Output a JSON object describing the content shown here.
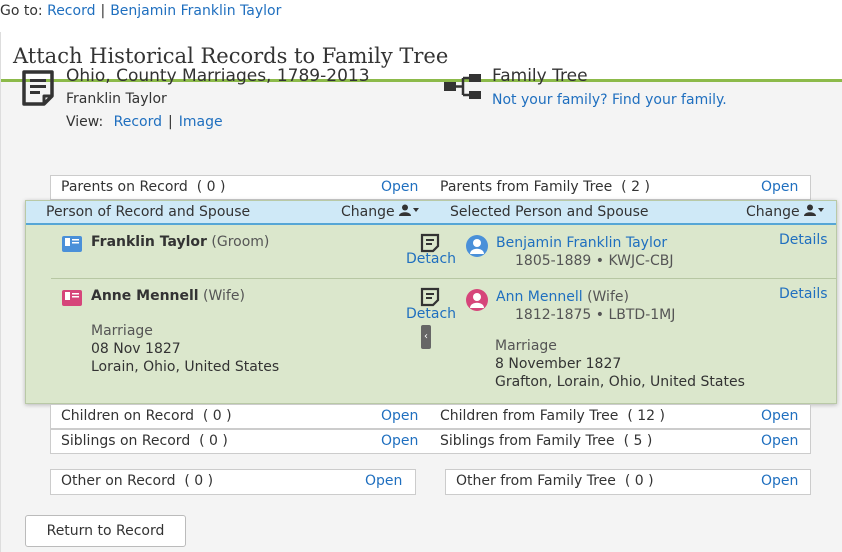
{
  "goto": {
    "label": "Go to:",
    "links": [
      "Record",
      "Benjamin Franklin Taylor"
    ],
    "separator": "|"
  },
  "title": "Attach Historical Records to Family Tree",
  "record": {
    "title": "Ohio, County Marriages, 1789-2013",
    "subject": "Franklin Taylor",
    "view_label": "View:",
    "view_links": [
      "Record",
      "Image"
    ],
    "separator": "|"
  },
  "tree": {
    "title": "Family Tree",
    "link": "Not your family? Find your family."
  },
  "parents_row": {
    "left_label": "Parents on Record",
    "left_count": "( 0 )",
    "left_action": "Open",
    "right_label": "Parents from Family Tree",
    "right_count": "( 2 )",
    "right_action": "Open"
  },
  "panel": {
    "left_header": "Person of Record and Spouse",
    "left_change": "Change",
    "right_header": "Selected Person and Spouse",
    "right_change": "Change",
    "persons": [
      {
        "record_name": "Franklin Taylor",
        "record_role": "(Groom)",
        "detach": "Detach",
        "tree_name": "Benjamin Franklin Taylor",
        "tree_role": "",
        "tree_meta": "1805-1889 • KWJC-CBJ",
        "details": "Details"
      },
      {
        "record_name": "Anne Mennell",
        "record_role": "(Wife)",
        "detach": "Detach",
        "tree_name": "Ann Mennell",
        "tree_role": "(Wife)",
        "tree_meta": "1812-1875 • LBTD-1MJ",
        "details": "Details"
      }
    ],
    "record_event": {
      "type": "Marriage",
      "date": "08 Nov 1827",
      "place": "Lorain, Ohio, United States"
    },
    "tree_event": {
      "type": "Marriage",
      "date": "8 November 1827",
      "place": "Grafton, Lorain, Ohio, United States"
    },
    "collapse_glyph": "‹"
  },
  "children_row": {
    "left_label": "Children on Record",
    "left_count": "( 0 )",
    "left_action": "Open",
    "right_label": "Children from Family Tree",
    "right_count": "( 12 )",
    "right_action": "Open"
  },
  "siblings_row": {
    "left_label": "Siblings on Record",
    "left_count": "( 0 )",
    "left_action": "Open",
    "right_label": "Siblings from Family Tree",
    "right_count": "( 5 )",
    "right_action": "Open"
  },
  "other_left": {
    "label": "Other on Record",
    "count": "( 0 )",
    "action": "Open"
  },
  "other_right": {
    "label": "Other from Family Tree",
    "count": "( 0 )",
    "action": "Open"
  },
  "return_button": "Return to Record",
  "icons": {
    "record_doc": "document-icon",
    "tree": "family-tree-icon",
    "person_menu": "person-menu-icon",
    "detach": "detach-icon",
    "male_badge": "male-record-badge-icon",
    "female_badge": "female-record-badge-icon",
    "male_avatar": "male-avatar-icon",
    "female_avatar": "female-avatar-icon"
  },
  "colors": {
    "accent_green": "#8cba4a",
    "link_blue": "#1f6fbf",
    "panel_green": "#dbe7cc",
    "panel_header_blue": "#cfe9f7",
    "male": "#4a90d9",
    "female": "#d6457a"
  }
}
